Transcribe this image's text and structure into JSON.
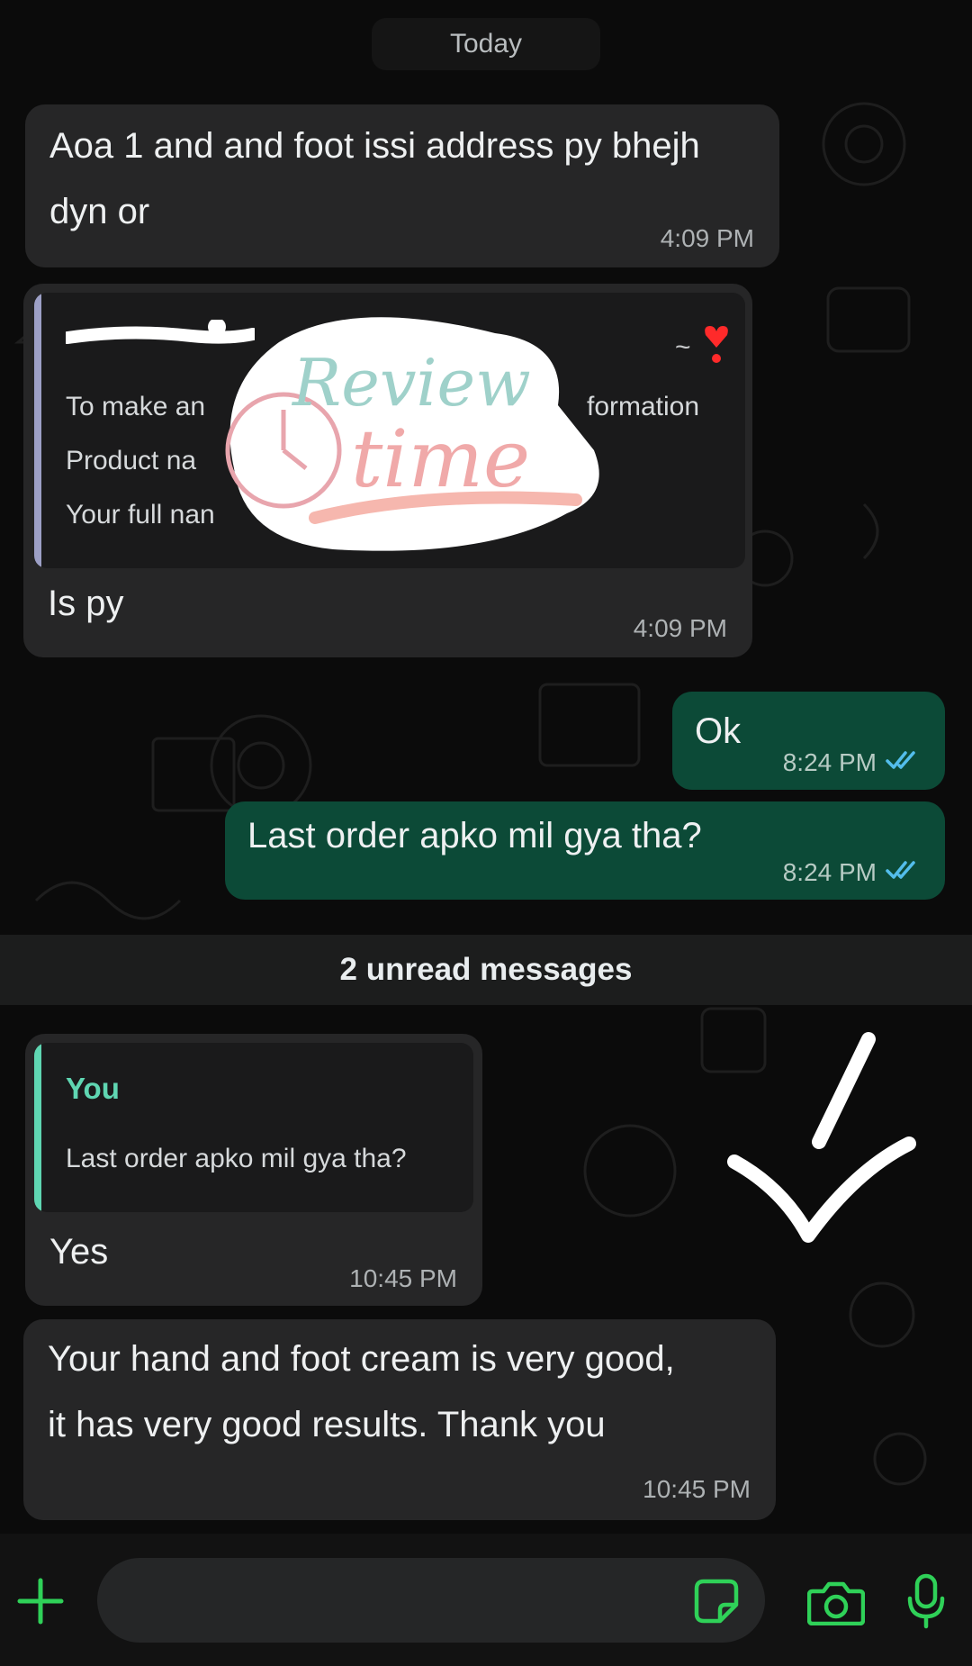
{
  "date_separator": "Today",
  "messages": {
    "m1": {
      "text_line1": "Aoa 1 and and foot issi address py bhejh",
      "text_line2": "dyn or",
      "time": "4:09 PM"
    },
    "m2": {
      "quote_header_end": "~",
      "quote_lines": [
        "To make an",
        "Product na",
        "Your full nan"
      ],
      "quote_line1_tail": "formation",
      "text": "Is py",
      "time": "4:09 PM"
    },
    "m3": {
      "text": "Ok",
      "time": "8:24 PM"
    },
    "m4": {
      "text": "Last order apko mil gya tha?",
      "time": "8:24 PM"
    },
    "m5": {
      "quote_author": "You",
      "quote_text": "Last order apko mil gya tha?",
      "text": "Yes",
      "time": "10:45 PM"
    },
    "m6": {
      "text_line1": "Your hand and foot cream is very good,",
      "text_line2": "it has very good results. Thank you",
      "time": "10:45 PM"
    }
  },
  "unread_label": "2 unread messages",
  "sticker": {
    "word1": "Review",
    "word2": "time"
  },
  "colors": {
    "incoming": "#262627",
    "outgoing": "#0c4a37",
    "accent": "#2fd158",
    "quote_bar_you": "#5fd6b2",
    "read_ticks": "#53bdeb"
  },
  "icons": {
    "attach": "plus-icon",
    "sticker": "sticker-icon",
    "camera": "camera-icon",
    "mic": "microphone-icon",
    "read": "double-check-icon",
    "heart": "heart-icon"
  }
}
